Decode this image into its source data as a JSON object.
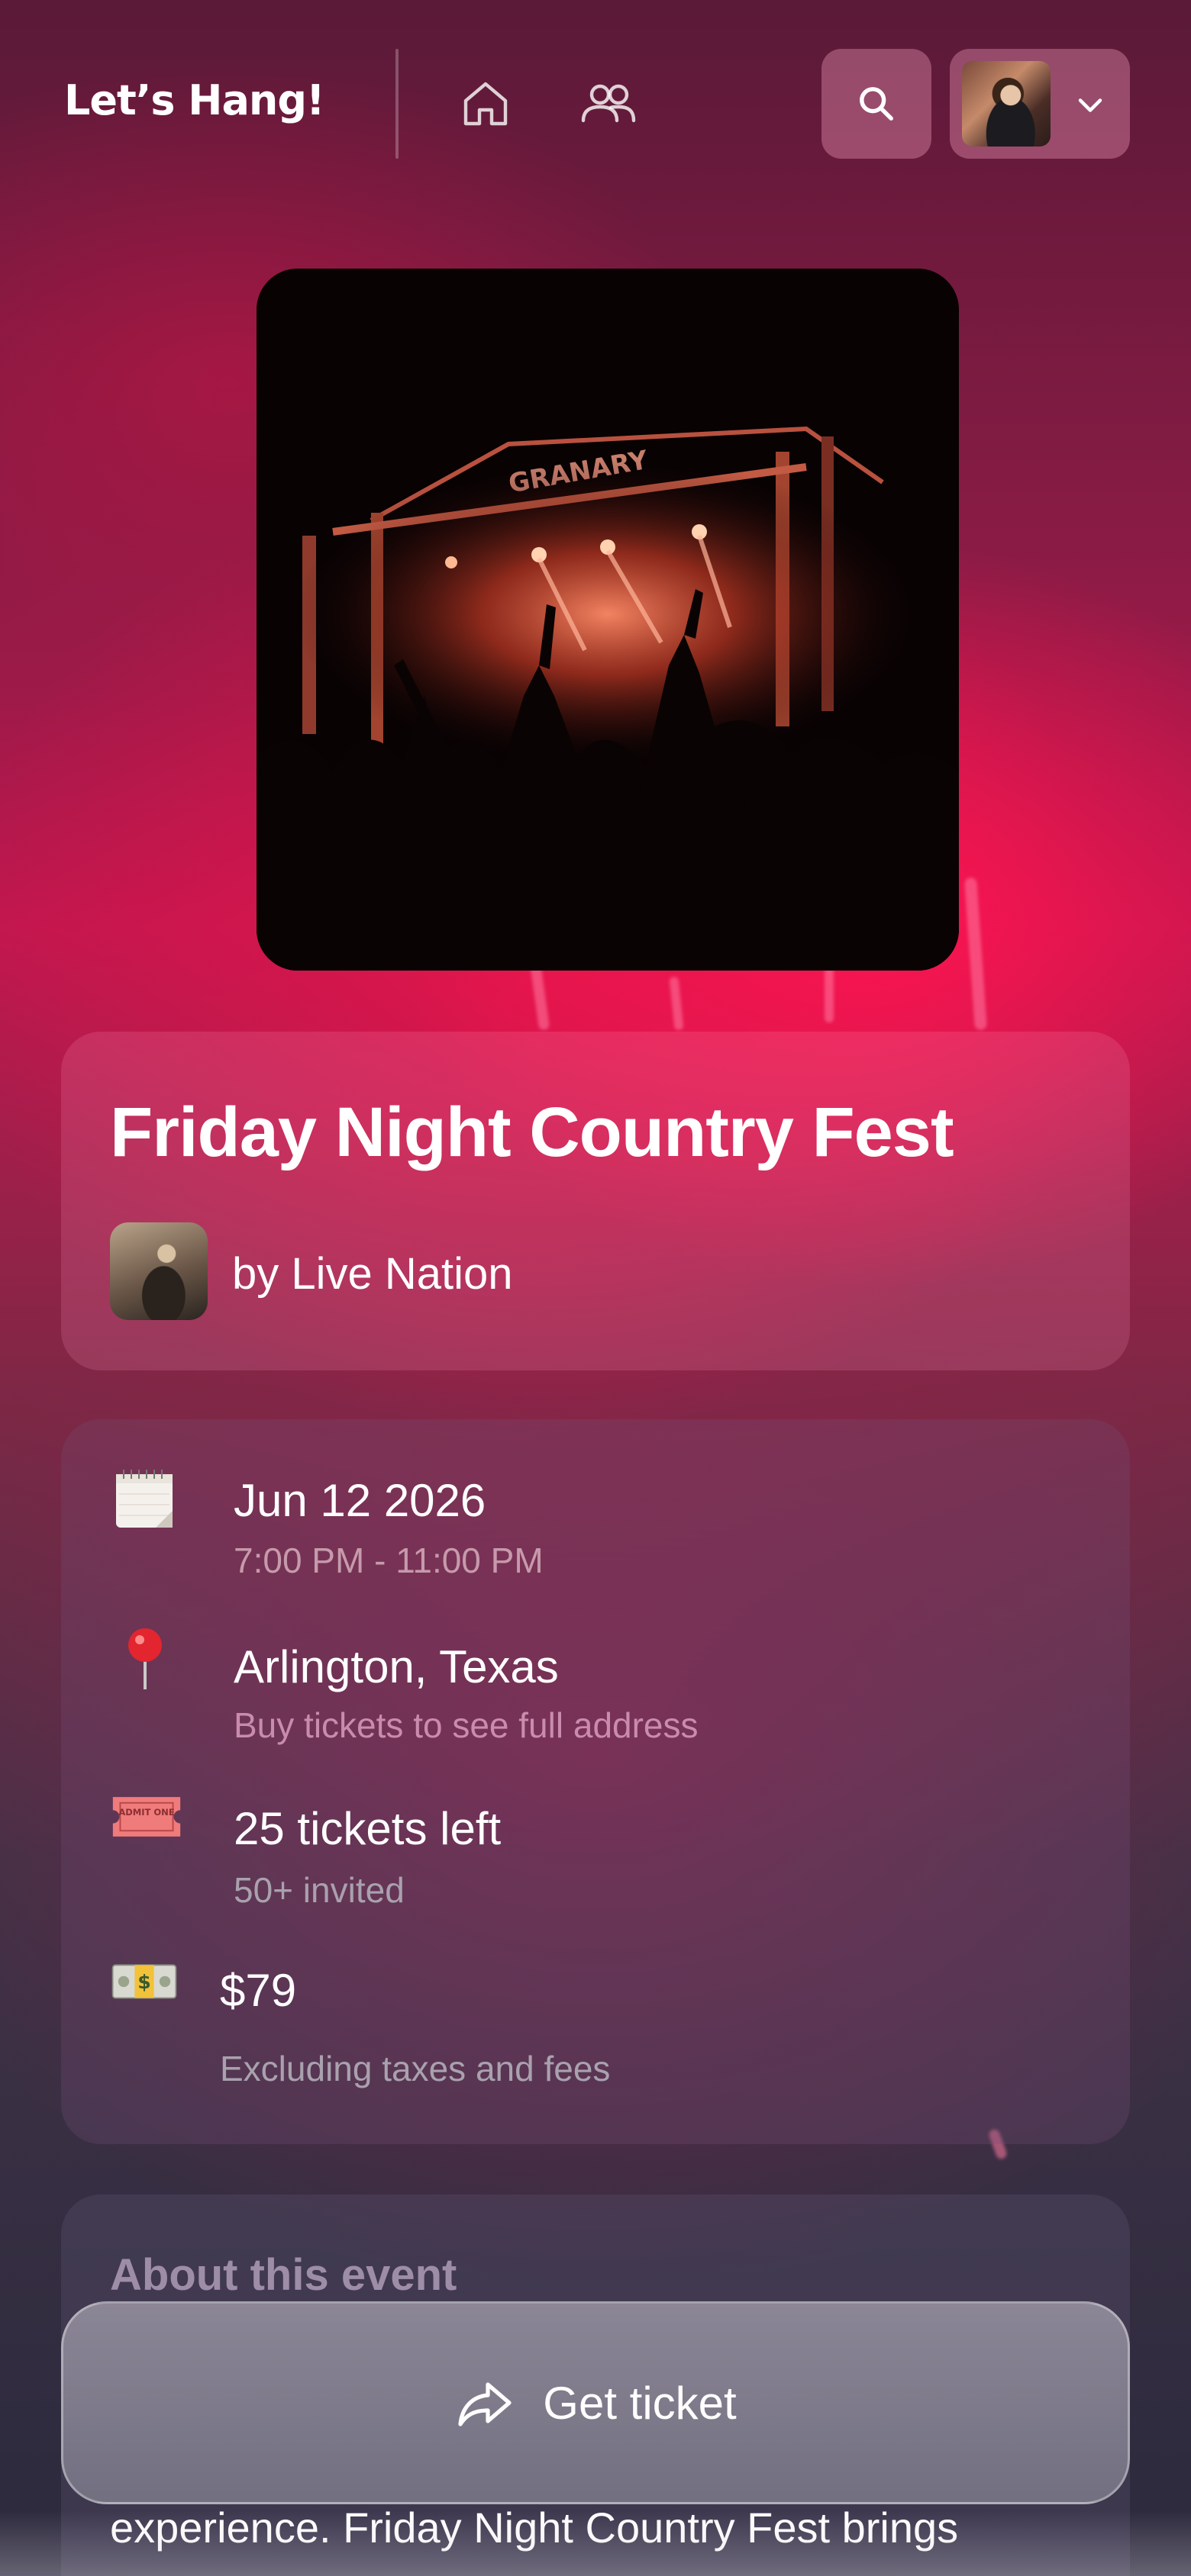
{
  "header": {
    "logo": "Let’s Hang!"
  },
  "event": {
    "title": "Friday Night Country Fest",
    "organizer": "by Live Nation",
    "hero_stage_sign": "GRANARY"
  },
  "details": {
    "date": "Jun 12 2026",
    "time": "7:00 PM - 11:00 PM",
    "location": "Arlington, Texas",
    "location_note": "Buy tickets to see full address",
    "tickets": "25 tickets left",
    "invited": "50+ invited",
    "price": "$79",
    "price_note": "Excluding taxes and fees",
    "ticket_badge": "ADMIT ONE"
  },
  "about": {
    "heading": "About this event",
    "text": "experience. Friday Night Country Fest brings"
  },
  "cta": {
    "label": "Get ticket"
  },
  "colors": {
    "accent": "#e8184f",
    "time_text": "#c69aab",
    "location_note_text": "#c98cad",
    "muted_text": "#a9a1ae"
  },
  "icons": [
    "home-icon",
    "friends-icon",
    "search-icon",
    "chevron-down-icon",
    "calendar-icon",
    "pin-icon",
    "ticket-icon",
    "money-icon",
    "share-icon"
  ]
}
